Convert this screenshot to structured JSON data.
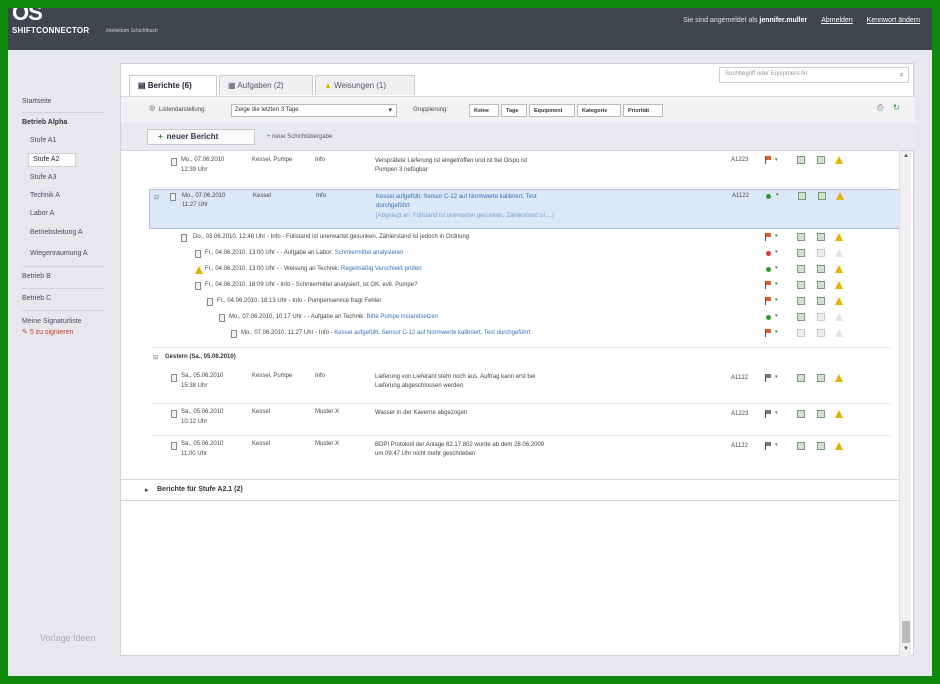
{
  "app": {
    "logo_mark": "OS",
    "name": "SHIFTCONNECTOR",
    "subtitle": "Intelektum Schichtbuch"
  },
  "header": {
    "logged_in_text": "Sie sind angemeldet als",
    "user": "jennifer.muller",
    "logout": "Abmelden",
    "settings": "Kennwort ändern"
  },
  "sidebar": {
    "items": [
      "Startseite",
      "Betrieb Alpha",
      "Stufe A1",
      "Stufe A2",
      "Stufe A3",
      "Technik A",
      "Labor A",
      "Betriebsleitung A",
      "Wiegenraumung A",
      "Betrieb B",
      "Betrieb C"
    ],
    "signatures_label": "Meine Signaturliste",
    "signatures_count": "5 zu signieren",
    "watermark": "Vorlage Ideen"
  },
  "tabs": [
    {
      "label": "Berichte (6)",
      "icon": "document-icon"
    },
    {
      "label": "Aufgaben (2)",
      "icon": "task-icon"
    },
    {
      "label": "Weisungen (1)",
      "icon": "warning-icon"
    }
  ],
  "search": {
    "placeholder": "Suchbegriff oder Equipment-Nr."
  },
  "filter": {
    "display_label": "Listendarstellung:",
    "period": "Zeige die letzten 3 Tage",
    "group_label": "Gruppierung:",
    "groups": [
      "Keine",
      "Tage",
      "Equipment",
      "Kategorie",
      "Priorität"
    ]
  },
  "actions": {
    "new_report": "neuer Bericht",
    "new_shift": "neue Schichtübergabe"
  },
  "reports": [
    {
      "date": "Mo., 07.06.2010",
      "time": "12:39 Uhr",
      "equipment": "Kessel, Pumpe",
      "category": "Info",
      "text": "Versprätete Lieferung ist eingetroffen und ist bei Dispo ist",
      "text2": "Pumpen 3 nefügbar",
      "station": "A1223",
      "status": "flag-red"
    },
    {
      "date": "Mo., 07.06.2010",
      "time": "11:27 Uhr",
      "equipment": "Kessel",
      "category": "Info",
      "text": "Kessel aufgefüllt, Sensor C-12 auf Normwerte kalibriert, Test",
      "text2": "durchgeführt",
      "text3": "[Abgelegt an: Füllstand ist unerwartet gesunken, Zählerstand ist ...]",
      "station": "A1122",
      "status": "dot-green"
    }
  ],
  "thread": [
    {
      "text": "Do., 03.06.2010, 12:48 Uhr - Info - Füllstand ist unerwartet gesunken, Zählerstand ist jedoch in Ordnung",
      "status": "flag-red",
      "kind": "doc"
    },
    {
      "text": "Fr., 04.06.2010, 13:00 Uhr - - Aufgabe an Labor:",
      "link": "Schmiermittel analysieren",
      "status": "dot-red",
      "kind": "doc"
    },
    {
      "text": "Fr., 04.06.2010, 13:00 Uhr - - Weisung an Technik:",
      "link": "Regelmäßig Verschleiß prüfen",
      "status": "dot-green",
      "kind": "warn"
    },
    {
      "text": "Fr., 04.06.2010, 18:09 Uhr - Info - Schmiermittel analysiert, ist OK, evtl. Pumpe?",
      "status": "flag-red",
      "kind": "doc"
    },
    {
      "text": "Fr., 04.06.2010, 18:13 Uhr - Info - Pumpenservice fragt Fehler",
      "status": "flag-red",
      "kind": "doc"
    },
    {
      "text": "Mo., 07.06.2010, 10:17 Uhr - - Aufgabe an Technik:",
      "link": "Bitte Pumpe instandsetzen",
      "status": "dot-green",
      "kind": "task"
    },
    {
      "text": "Mo., 07.06.2010, 11:27 Uhr - Info -",
      "link": "Kessel aufgefüllt, Sensor C-12 auf Normwerte kalibriert, Test durchgeführt",
      "status": "flag-red",
      "kind": "doc"
    }
  ],
  "group_yesterday": {
    "label": "Gestern (Sa., 05.06.2010)"
  },
  "reports_yesterday": [
    {
      "date": "Sa., 05.06.2010",
      "time": "15:38 Uhr",
      "equipment": "Kessel, Pumpe",
      "category": "Info",
      "text": "Lieferung von Lieferant steht noch aus, Auftrag kann erst bei",
      "text2": "Lieferung abgeschlossen werden",
      "station": "A1122"
    },
    {
      "date": "Sa., 05.06.2010",
      "time": "10:12 Uhr",
      "equipment": "Kessel",
      "category": "Muster X",
      "text": "Wasser in der Kaverne abgezogen",
      "text2": "",
      "station": "A1223"
    },
    {
      "date": "Sa., 05.06.2010",
      "time": "11:00 Uhr",
      "equipment": "Kessel",
      "category": "Muster X",
      "text": "BDPI Protokoll der Anlage 82.17.802 wurde ab dem 28.06.2009",
      "text2": "um 09:47 Uhr nicht mehr geschrieben",
      "station": "A1122"
    }
  ],
  "group2": {
    "label": "Berichte für Stufe A2.1 (2)"
  },
  "colors": {
    "accent": "#3a6fb2",
    "header": "#3f4650",
    "highlight": "#dce8f8",
    "flag": "#e0602a",
    "ok": "#2a9a2a",
    "warn": "#e0b400",
    "frame": "#0f8a0f"
  }
}
